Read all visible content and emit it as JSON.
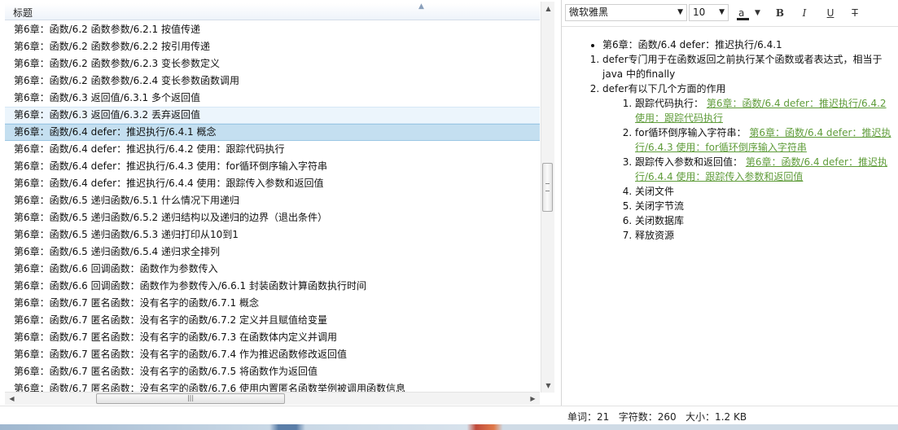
{
  "list": {
    "header_title": "标题",
    "rows": [
      "第6章：函数/6.2 函数参数/6.2.1 按值传递",
      "第6章：函数/6.2 函数参数/6.2.2 按引用传递",
      "第6章：函数/6.2 函数参数/6.2.3 变长参数定义",
      "第6章：函数/6.2 函数参数/6.2.4 变长参数函数调用",
      "第6章：函数/6.3 返回值/6.3.1 多个返回值",
      "第6章：函数/6.3 返回值/6.3.2 丢弃返回值",
      "第6章：函数/6.4 defer：推迟执行/6.4.1 概念",
      "第6章：函数/6.4 defer：推迟执行/6.4.2 使用：跟踪代码执行",
      "第6章：函数/6.4 defer：推迟执行/6.4.3 使用：for循环倒序输入字符串",
      "第6章：函数/6.4 defer：推迟执行/6.4.4 使用：跟踪传入参数和返回值",
      "第6章：函数/6.5 递归函数/6.5.1 什么情况下用递归",
      "第6章：函数/6.5 递归函数/6.5.2 递归结构以及递归的边界（退出条件）",
      "第6章：函数/6.5 递归函数/6.5.3 递归打印从10到1",
      "第6章：函数/6.5 递归函数/6.5.4 递归求全排列",
      "第6章：函数/6.6 回调函数：函数作为参数传入",
      "第6章：函数/6.6 回调函数：函数作为参数传入/6.6.1 封装函数计算函数执行时间",
      "第6章：函数/6.7 匿名函数：没有名字的函数/6.7.1 概念",
      "第6章：函数/6.7 匿名函数：没有名字的函数/6.7.2 定义并且赋值给变量",
      "第6章：函数/6.7 匿名函数：没有名字的函数/6.7.3 在函数体内定义并调用",
      "第6章：函数/6.7 匿名函数：没有名字的函数/6.7.4 作为推迟函数修改返回值",
      "第6章：函数/6.7 匿名函数：没有名字的函数/6.7.5 将函数作为返回值",
      "第6章：函数/6.7 匿名函数：没有名字的函数/6.7.6 使用内置匿名函数举例被调用函数信息"
    ],
    "hover_index": 5,
    "selected_index": 6
  },
  "toolbar": {
    "font_family": "微软雅黑",
    "font_size": "10",
    "color_glyph": "a",
    "bold": "B",
    "italic": "I",
    "underline": "U",
    "strike": "T"
  },
  "doc": {
    "bullet": "第6章：函数/6.4 defer：推迟执行/6.4.1",
    "item1": "defer专门用于在函数返回之前执行某个函数或者表达式，相当于java 中的finally",
    "item2": "defer有以下几个方面的作用",
    "sub1_text": "跟踪代码执行：",
    "sub1_link": "第6章：函数/6.4 defer：推迟执行/6.4.2 使用：跟踪代码执行",
    "sub2_text": "for循环倒序输入字符串：",
    "sub2_link": "第6章：函数/6.4 defer：推迟执行/6.4.3 使用：for循环倒序输入字符串",
    "sub3_text": "跟踪传入参数和返回值：",
    "sub3_link": "第6章：函数/6.4 defer：推迟执行/6.4.4 使用：跟踪传入参数和返回值",
    "sub4": "关闭文件",
    "sub5": "关闭字节流",
    "sub6": "关闭数据库",
    "sub7": "释放资源",
    "link_color": "#5f9c3a"
  },
  "status": {
    "text": "单词：21   字符数：260   大小：1.2 KB"
  }
}
